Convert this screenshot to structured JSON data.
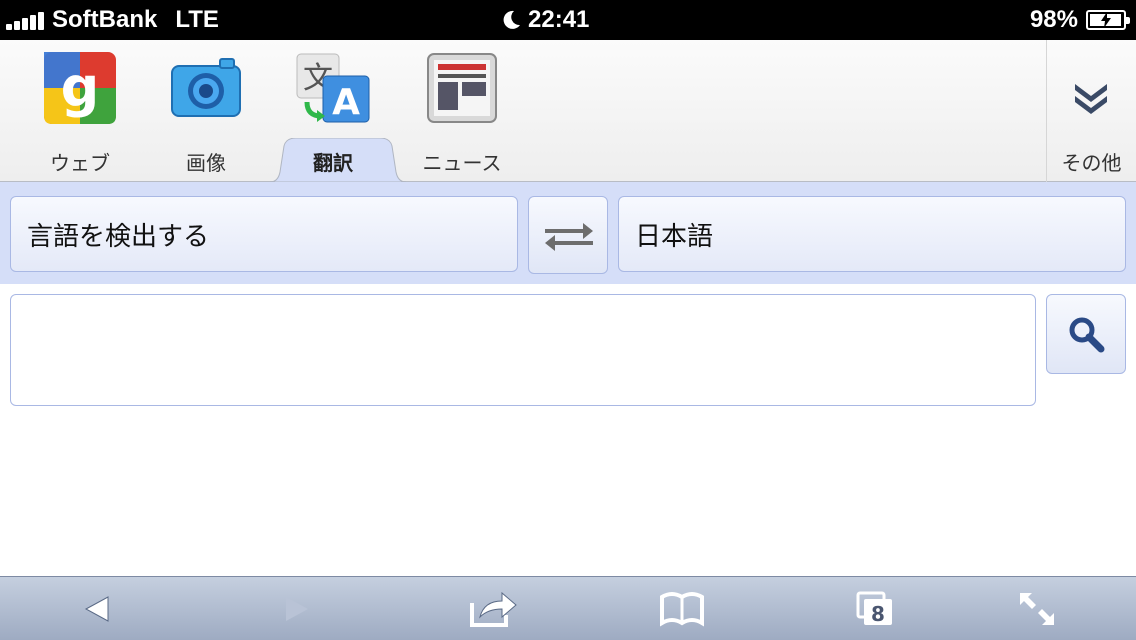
{
  "status_bar": {
    "carrier": "SoftBank",
    "network": "LTE",
    "time": "22:41",
    "battery": "98%",
    "battery_level": 0.98,
    "signal_bars": 5
  },
  "nav_tabs": [
    {
      "label": "ウェブ",
      "icon": "google-icon",
      "active": false
    },
    {
      "label": "画像",
      "icon": "camera-icon",
      "active": false
    },
    {
      "label": "翻訳",
      "icon": "translate-icon",
      "active": true
    },
    {
      "label": "ニュース",
      "icon": "news-icon",
      "active": false
    }
  ],
  "more": {
    "label": "その他",
    "icon": "double-chevron-down-icon"
  },
  "language": {
    "source": "言語を検出する",
    "target": "日本語"
  },
  "input": {
    "value": "",
    "placeholder": ""
  },
  "toolbar": {
    "tabs_count": "8",
    "buttons": [
      "back-icon",
      "forward-icon",
      "share-icon",
      "bookmarks-icon",
      "tabs-icon",
      "fullscreen-icon"
    ]
  },
  "colors": {
    "accent_bg": "#d5def8",
    "button_border": "#a9b8e4",
    "toolbar_icon": "#ffffff"
  }
}
